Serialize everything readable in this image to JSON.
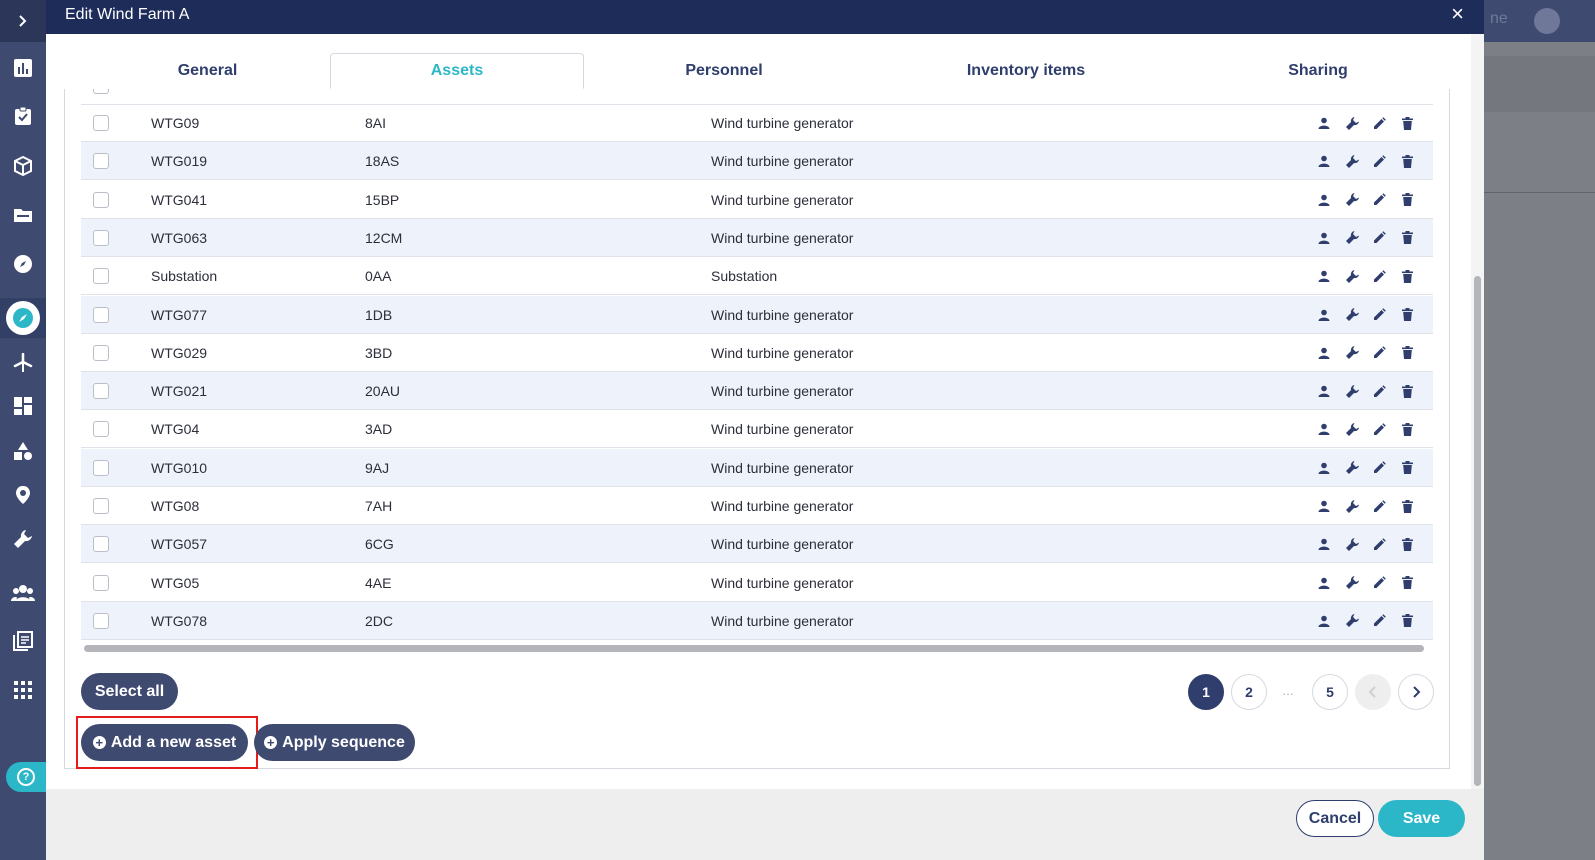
{
  "modal": {
    "title": "Edit Wind Farm A",
    "close_label": "×"
  },
  "tabs": [
    {
      "label": "General",
      "active": false
    },
    {
      "label": "Assets",
      "active": true
    },
    {
      "label": "Personnel",
      "active": false
    },
    {
      "label": "Inventory items",
      "active": false
    },
    {
      "label": "Sharing",
      "active": false
    }
  ],
  "assets_table": {
    "rows": [
      {
        "name": "WTG09",
        "code": "8AI",
        "type": "Wind turbine generator"
      },
      {
        "name": "WTG019",
        "code": "18AS",
        "type": "Wind turbine generator"
      },
      {
        "name": "WTG041",
        "code": "15BP",
        "type": "Wind turbine generator"
      },
      {
        "name": "WTG063",
        "code": "12CM",
        "type": "Wind turbine generator"
      },
      {
        "name": "Substation",
        "code": "0AA",
        "type": "Substation"
      },
      {
        "name": "WTG077",
        "code": "1DB",
        "type": "Wind turbine generator"
      },
      {
        "name": "WTG029",
        "code": "3BD",
        "type": "Wind turbine generator"
      },
      {
        "name": "WTG021",
        "code": "20AU",
        "type": "Wind turbine generator"
      },
      {
        "name": "WTG04",
        "code": "3AD",
        "type": "Wind turbine generator"
      },
      {
        "name": "WTG010",
        "code": "9AJ",
        "type": "Wind turbine generator"
      },
      {
        "name": "WTG08",
        "code": "7AH",
        "type": "Wind turbine generator"
      },
      {
        "name": "WTG057",
        "code": "6CG",
        "type": "Wind turbine generator"
      },
      {
        "name": "WTG05",
        "code": "4AE",
        "type": "Wind turbine generator"
      },
      {
        "name": "WTG078",
        "code": "2DC",
        "type": "Wind turbine generator"
      }
    ],
    "row_actions": [
      "person-icon",
      "wrench-icon",
      "pencil-icon",
      "trash-icon"
    ]
  },
  "actions": {
    "select_all": "Select all",
    "add_asset": "Add a new asset",
    "apply_sequence": "Apply sequence"
  },
  "pagination": {
    "pages": [
      "1",
      "2",
      "…",
      "5"
    ],
    "current": "1"
  },
  "footer": {
    "cancel": "Cancel",
    "save": "Save"
  },
  "background": {
    "header_fragment": "ne"
  },
  "colors": {
    "header_bg": "#1e2c5a",
    "sidebar_bg": "#3f4a71",
    "accent": "#2cb7c8",
    "primary": "#2f3e6d",
    "row_alt": "#eef2fa",
    "highlight": "#e41c1c"
  }
}
